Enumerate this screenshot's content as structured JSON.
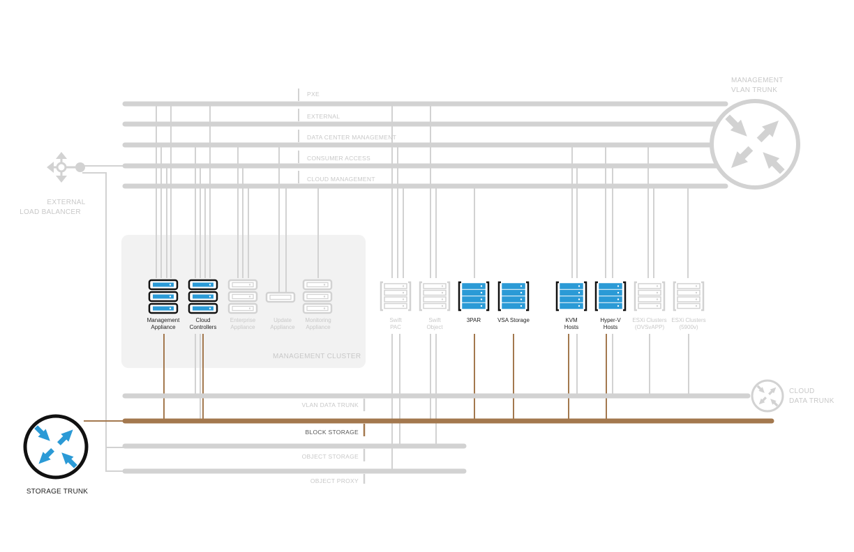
{
  "networks": {
    "pxe": "PXE",
    "external": "EXTERNAL",
    "dcm": "DATA CENTER MANAGEMENT",
    "consumer": "CONSUMER ACCESS",
    "cloud_mgmt": "CLOUD MANAGEMENT",
    "vlan_data": "VLAN DATA TRUNK",
    "block": "BLOCK STORAGE",
    "object": "OBJECT STORAGE",
    "proxy": "OBJECT PROXY"
  },
  "routers": {
    "management_l1": "MANAGEMENT",
    "management_l2": "VLAN TRUNK",
    "cloud_l1": "CLOUD",
    "cloud_l2": "DATA TRUNK",
    "storage": "STORAGE TRUNK"
  },
  "load_balancer": {
    "l1": "EXTERNAL",
    "l2": "LOAD BALANCER"
  },
  "cluster": {
    "label": "MANAGEMENT CLUSTER"
  },
  "nodes": [
    {
      "key": "mgmt",
      "l1": "Management",
      "l2": "Appliance",
      "active": true
    },
    {
      "key": "cloud",
      "l1": "Cloud",
      "l2": "Controllers",
      "active": true
    },
    {
      "key": "enterprise",
      "l1": "Enterprise",
      "l2": "Appliance",
      "active": false
    },
    {
      "key": "update",
      "l1": "Update",
      "l2": "Appliance",
      "active": false
    },
    {
      "key": "monitoring",
      "l1": "Monitoring",
      "l2": "Appliance",
      "active": false
    },
    {
      "key": "swiftpac",
      "l1": "Swift",
      "l2": "PAC",
      "active": false
    },
    {
      "key": "swiftobj",
      "l1": "Swift",
      "l2": "Object",
      "active": false
    },
    {
      "key": "3par",
      "l1": "3PAR",
      "l2": "",
      "active": true
    },
    {
      "key": "vsa",
      "l1": "VSA Storage",
      "l2": "",
      "active": true
    },
    {
      "key": "kvm",
      "l1": "KVM",
      "l2": "Hosts",
      "active": true
    },
    {
      "key": "hyperv",
      "l1": "Hyper-V",
      "l2": "Hosts",
      "active": true
    },
    {
      "key": "esxovs",
      "l1": "ESXi Clusters",
      "l2": "(OVSvAPP)",
      "active": false
    },
    {
      "key": "esx5900",
      "l1": "ESXi Clusters",
      "l2": "(5900v)",
      "active": false
    }
  ],
  "colors": {
    "gray_line": "#d2d2d2",
    "block_storage": "#a3784e",
    "accent_blue": "#2b9ad6",
    "dark": "#111111"
  }
}
